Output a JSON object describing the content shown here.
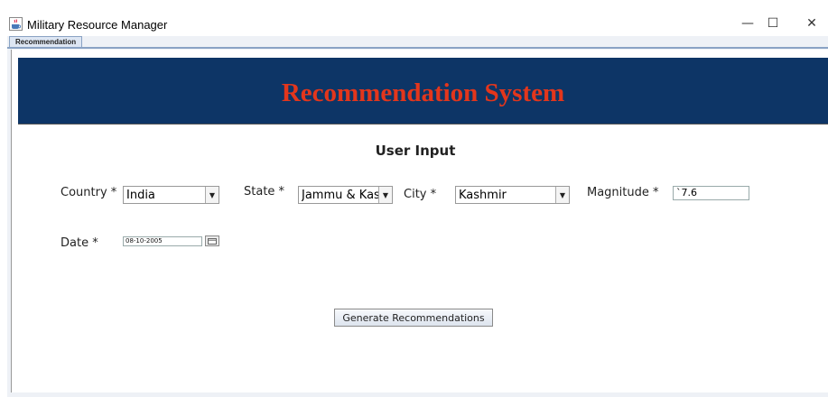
{
  "window": {
    "title": "Military Resource Manager",
    "app_icon": "java-coffee-icon",
    "minimize_glyph": "—",
    "maximize_glyph": "☐",
    "close_glyph": "✕"
  },
  "tabs": [
    {
      "label": "Recommendation",
      "selected": true
    }
  ],
  "header": {
    "title": "Recommendation System",
    "bg_color": "#0d3566",
    "title_color": "#e3361c"
  },
  "form": {
    "section_title": "User Input",
    "country": {
      "label": "Country *",
      "value": "India"
    },
    "state": {
      "label": "State *",
      "value": "Jammu & Kashmir"
    },
    "city": {
      "label": "City *",
      "value": "Kashmir"
    },
    "magnitude": {
      "label": "Magnitude *",
      "value": "`7.6"
    },
    "date": {
      "label": "Date *",
      "value": "08-10-2005"
    },
    "generate_button": "Generate Recommendations"
  }
}
